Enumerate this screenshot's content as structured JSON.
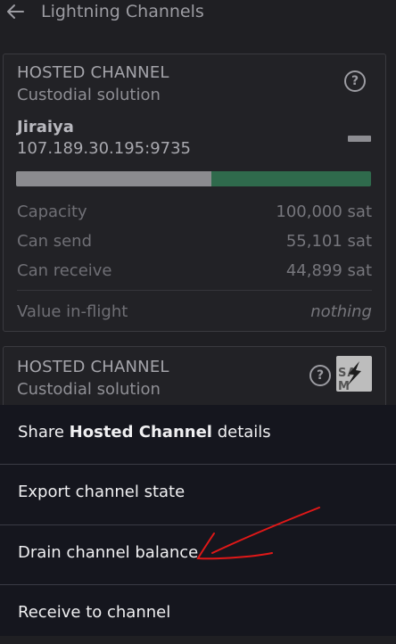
{
  "header": {
    "title": "Lightning Channels",
    "back_icon": "arrow-left-icon"
  },
  "channels": [
    {
      "type_label": "HOSTED CHANNEL",
      "subtitle": "Custodial solution",
      "peer_name": "Jiraiya",
      "peer_address": "107.189.30.195:9735",
      "balance_bar": {
        "local_fraction": 0.55,
        "local_color": "#8b8b8f",
        "remote_color": "#2f6a4c"
      },
      "stats": [
        {
          "label": "Capacity",
          "value": "100,000 sat"
        },
        {
          "label": "Can send",
          "value": "55,101 sat"
        },
        {
          "label": "Can receive",
          "value": "44,899 sat"
        }
      ],
      "inflight": {
        "label": "Value in-flight",
        "value": "nothing"
      }
    },
    {
      "type_label": "HOSTED CHANNEL",
      "subtitle": "Custodial solution",
      "logo_text": "SA  M"
    }
  ],
  "sheet": {
    "share": {
      "prefix": "Share ",
      "bold": "Hosted Channel",
      "suffix": " details"
    },
    "export": "Export channel state",
    "drain": "Drain channel balance",
    "receive": "Receive to channel"
  },
  "annotation_color": "#e01818"
}
